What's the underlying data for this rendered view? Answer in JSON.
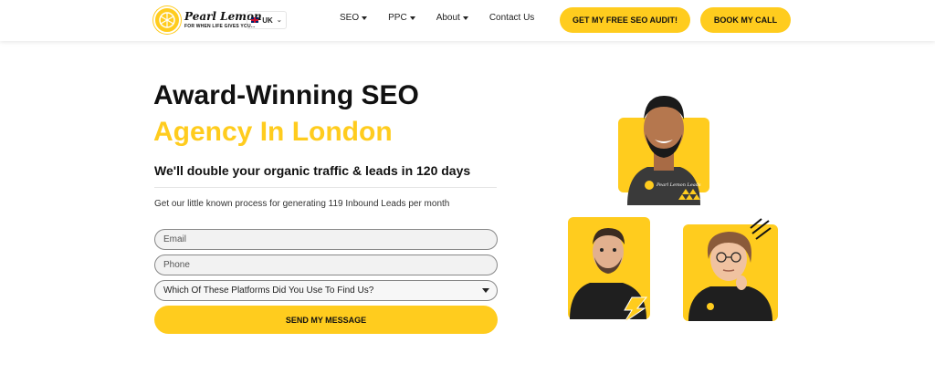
{
  "brand": {
    "name": "Pearl Lemon",
    "tagline": "FOR WHEN LIFE GIVES YOU...",
    "color": "#FFCC1E"
  },
  "header": {
    "language": "UK",
    "nav": [
      {
        "label": "SEO",
        "dropdown": true
      },
      {
        "label": "PPC",
        "dropdown": true
      },
      {
        "label": "About",
        "dropdown": true
      },
      {
        "label": "Contact Us",
        "dropdown": false
      }
    ],
    "audit_button": "GET MY FREE SEO AUDIT!",
    "call_button": "BOOK MY CALL"
  },
  "hero": {
    "title_line1": "Award-Winning SEO",
    "title_line2": "Agency In London",
    "subtitle": "We'll double your organic traffic & leads in 120 days",
    "description": "Get our little known process for generating 119 Inbound Leads per month"
  },
  "form": {
    "email_placeholder": "Email",
    "phone_placeholder": "Phone",
    "platform_select": "Which Of These Platforms Did You Use To Find Us?",
    "submit": "SEND MY MESSAGE"
  },
  "photos": {
    "card_text": "Pearl Lemon Leads"
  },
  "icons": [
    "lemon-logo-icon",
    "uk-flag-icon",
    "chevron-down-icon",
    "caret-down-icon",
    "lightning-bolt-icon",
    "scribble-icon"
  ]
}
